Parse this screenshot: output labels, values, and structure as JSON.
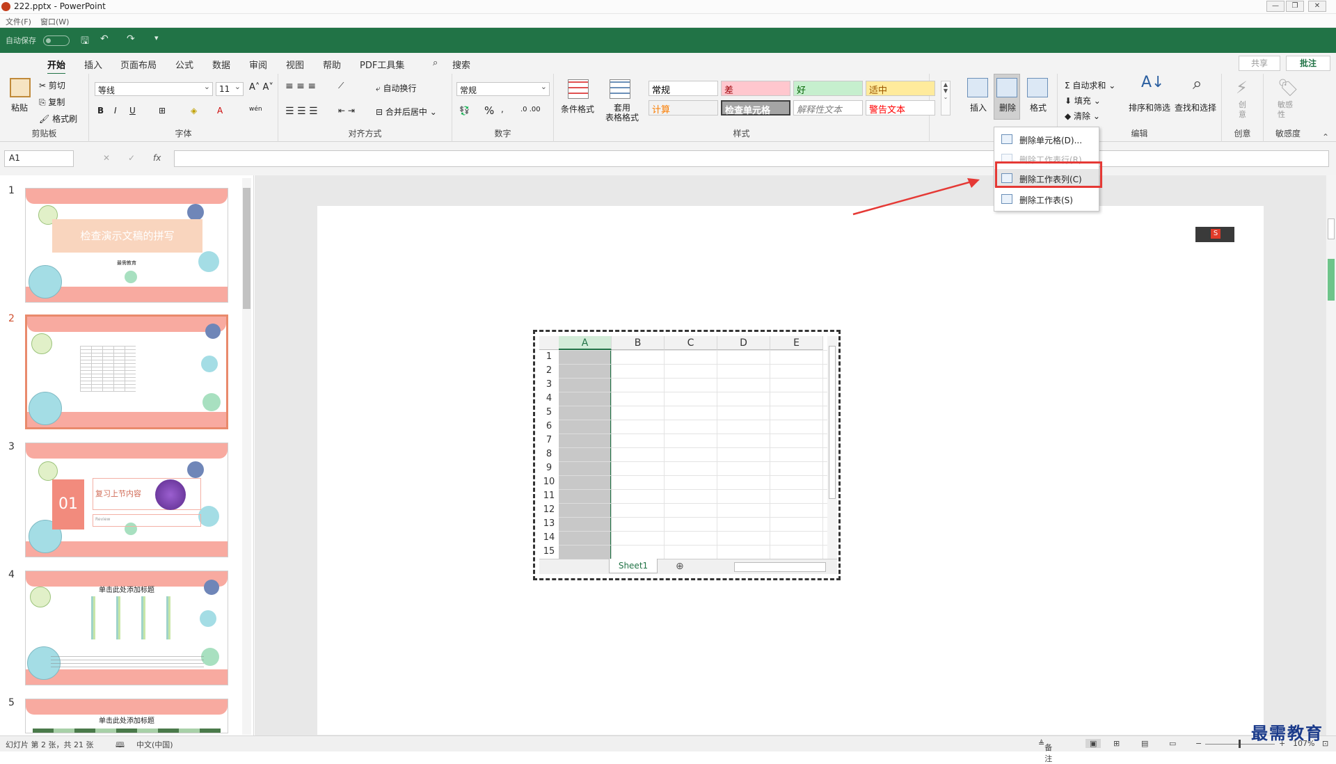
{
  "window": {
    "title": "222.pptx - PowerPoint"
  },
  "menubar": {
    "file": "文件(F)",
    "window": "窗口(W)"
  },
  "qat": {
    "autosave": "自动保存"
  },
  "tabs": [
    "开始",
    "插入",
    "页面布局",
    "公式",
    "数据",
    "审阅",
    "视图",
    "帮助",
    "PDF工具集"
  ],
  "search": {
    "label": "搜索"
  },
  "share": {
    "label": "共享",
    "comment": "批注"
  },
  "ribbon": {
    "clipboard": {
      "paste": "粘贴",
      "cut": "剪切",
      "copy": "复制",
      "format_painter": "格式刷",
      "group": "剪贴板"
    },
    "font": {
      "name": "等线",
      "size": "11",
      "group": "字体"
    },
    "align": {
      "wrap": "自动换行",
      "merge": "合并后居中",
      "group": "对齐方式"
    },
    "number": {
      "format": "常规",
      "percent": "%",
      "group": "数字"
    },
    "styles": {
      "cond_format": "条件格式",
      "table_format": "套用\n表格格式",
      "cells": [
        {
          "label": "常规",
          "bg": "#ffffff",
          "color": "#000000"
        },
        {
          "label": "差",
          "bg": "#ffc7ce",
          "color": "#9c0006"
        },
        {
          "label": "好",
          "bg": "#c6efce",
          "color": "#006100"
        },
        {
          "label": "适中",
          "bg": "#ffeb9c",
          "color": "#9c5700"
        },
        {
          "label": "计算",
          "bg": "#f2f2f2",
          "color": "#fa7d00"
        },
        {
          "label": "检查单元格",
          "bg": "#a5a5a5",
          "color": "#ffffff"
        },
        {
          "label": "解释性文本",
          "bg": "#ffffff",
          "color": "#7f7f7f"
        },
        {
          "label": "警告文本",
          "bg": "#ffffff",
          "color": "#ff0000"
        }
      ],
      "group": "样式"
    },
    "cells_group": {
      "insert": "插入",
      "delete": "删除",
      "format": "格式"
    },
    "edit": {
      "autosum": "自动求和",
      "fill": "填充",
      "clear": "清除",
      "sort": "排序和筛选",
      "find": "查找和选择",
      "group": "编辑"
    },
    "create": {
      "label": "创\n意",
      "group": "创意"
    },
    "sensitivity": {
      "label": "敏感\n性",
      "group": "敏感度"
    }
  },
  "formula_bar": {
    "cell": "A1",
    "fx": "fx"
  },
  "dropdown": [
    {
      "label": "删除单元格(D)...",
      "enabled": true
    },
    {
      "label": "删除工作表行(R)",
      "enabled": false
    },
    {
      "label": "删除工作表列(C)",
      "enabled": true,
      "highlighted": true
    },
    {
      "label": "删除工作表(S)",
      "enabled": true
    }
  ],
  "slides": [
    {
      "num": "1",
      "title": "检查演示文稿的拼写",
      "sub": "最需教育"
    },
    {
      "num": "2"
    },
    {
      "num": "3",
      "title": "复习上节内容",
      "number": "01",
      "sub": "Review"
    },
    {
      "num": "4",
      "title": "单击此处添加标题"
    },
    {
      "num": "5",
      "title": "单击此处添加标题"
    }
  ],
  "spreadsheet": {
    "columns": [
      "A",
      "B",
      "C",
      "D",
      "E"
    ],
    "rows": [
      "1",
      "2",
      "3",
      "4",
      "5",
      "6",
      "7",
      "8",
      "9",
      "10",
      "11",
      "12",
      "13",
      "14",
      "15"
    ],
    "sheet_tab": "Sheet1"
  },
  "status": {
    "slide_info": "幻灯片 第 2 张，共 21 张",
    "language": "中文(中国)",
    "notes": "备注",
    "zoom": "107%"
  },
  "watermark": "最需教育"
}
